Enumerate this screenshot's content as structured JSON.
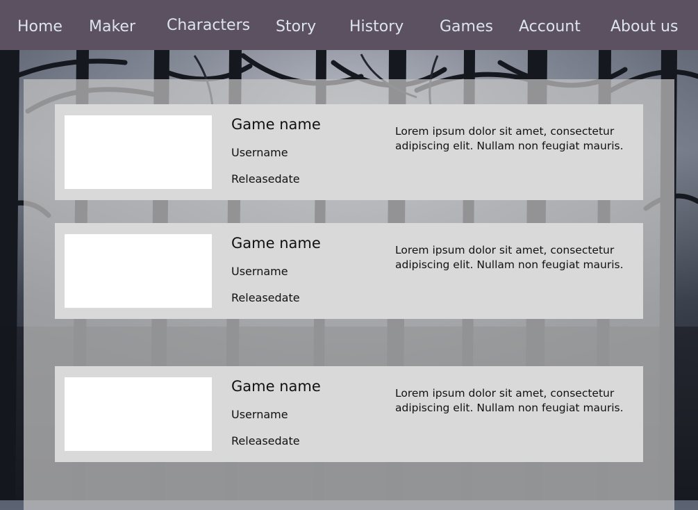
{
  "nav": {
    "items": [
      {
        "label": "Home"
      },
      {
        "label": "Maker"
      },
      {
        "label": "Characters"
      },
      {
        "label": "Story"
      },
      {
        "label": "History"
      },
      {
        "label": "Games"
      },
      {
        "label": "Account"
      },
      {
        "label": "About us"
      }
    ]
  },
  "games": [
    {
      "name": "Game name",
      "username": "Username",
      "release": "Releasedate",
      "description": "Lorem ipsum dolor sit amet, consectetur adipiscing elit. Nullam non feugiat mauris."
    },
    {
      "name": "Game name",
      "username": "Username",
      "release": "Releasedate",
      "description": "Lorem ipsum dolor sit amet, consectetur adipiscing elit. Nullam non feugiat mauris."
    },
    {
      "name": "Game name",
      "username": "Username",
      "release": "Releasedate",
      "description": "Lorem ipsum dolor sit amet, consectetur adipiscing elit. Nullam non feugiat mauris."
    }
  ],
  "colors": {
    "nav_background": "#5c5160",
    "nav_text": "#dde4ec",
    "card_background": "#d9d9d9",
    "thumbnail": "#ffffff"
  }
}
